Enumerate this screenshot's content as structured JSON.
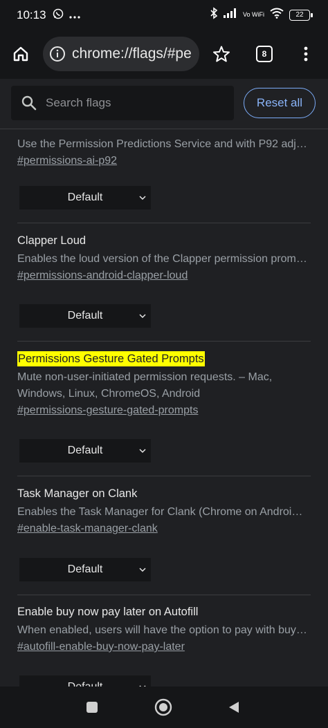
{
  "status_bar": {
    "time": "10:13",
    "network": "Vo WiFi",
    "battery": "22"
  },
  "toolbar": {
    "url": "chrome://flags/#pe",
    "tab_count": "8"
  },
  "search": {
    "placeholder": "Search flags",
    "reset_label": "Reset all"
  },
  "flags": [
    {
      "title": "",
      "description": "Use the Permission Predictions Service and with P92 adj…",
      "link": "#permissions-ai-p92",
      "value": "Default"
    },
    {
      "title": "Clapper Loud",
      "description": "Enables the loud version of the Clapper permission prom…",
      "link": "#permissions-android-clapper-loud",
      "value": "Default"
    },
    {
      "title": "Permissions Gesture Gated Prompts",
      "description": "Mute non-user-initiated permission requests. – Mac, Windows, Linux, ChromeOS, Android",
      "link": "#permissions-gesture-gated-prompts",
      "value": "Default",
      "highlighted": true
    },
    {
      "title": "Task Manager on Clank",
      "description": "Enables the Task Manager for Clank (Chrome on Androi…",
      "link": "#enable-task-manager-clank",
      "value": "Default"
    },
    {
      "title": "Enable buy now pay later on Autofill",
      "description": "When enabled, users will have the option to pay with buy…",
      "link": "#autofill-enable-buy-now-pay-later",
      "value": "Default"
    }
  ],
  "colors": {
    "background": "#202124",
    "highlight": "#ffff00",
    "accent": "#8ab4f8"
  }
}
